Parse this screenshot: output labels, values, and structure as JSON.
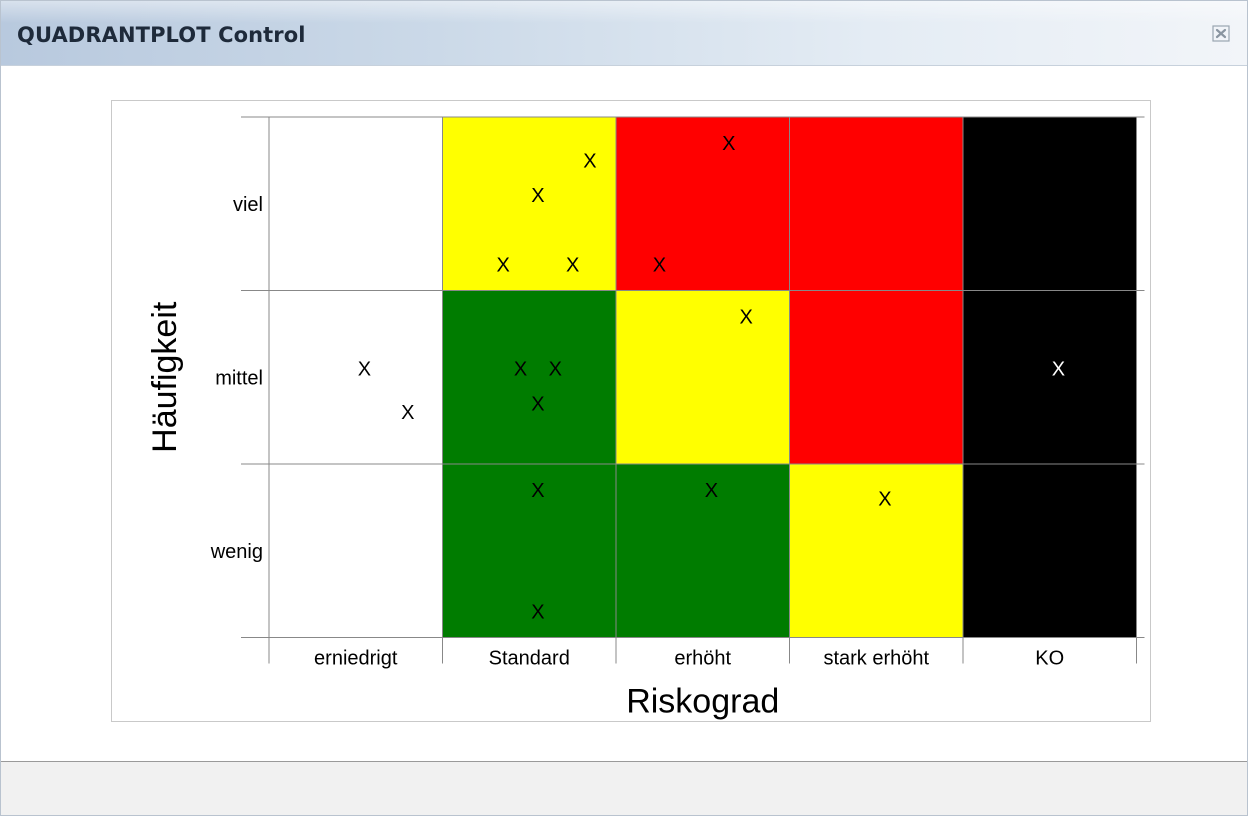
{
  "window": {
    "title": "QUADRANTPLOT Control",
    "close_icon": "close-icon"
  },
  "colors": {
    "green": "#007c00",
    "yellow": "#ffff00",
    "red": "#ff0000",
    "black": "#000000",
    "white": "#ffffff"
  },
  "chart_data": {
    "type": "heatmap",
    "xlabel": "Riskograd",
    "ylabel": "Häufigkeit",
    "x_categories": [
      "erniedrigt",
      "Standard",
      "erhöht",
      "stark erhöht",
      "KO"
    ],
    "y_categories": [
      "wenig",
      "mittel",
      "viel"
    ],
    "cell_colors": [
      [
        "white",
        "green",
        "green",
        "yellow",
        "black"
      ],
      [
        "white",
        "green",
        "yellow",
        "red",
        "black"
      ],
      [
        "white",
        "yellow",
        "red",
        "red",
        "black"
      ]
    ],
    "marker_symbol": "X",
    "points": [
      {
        "x": "erniedrigt",
        "y": "mittel",
        "dx": 0.55,
        "dy": 0.55
      },
      {
        "x": "erniedrigt",
        "y": "mittel",
        "dx": 0.8,
        "dy": 0.3
      },
      {
        "x": "Standard",
        "y": "viel",
        "dx": 0.85,
        "dy": 0.75
      },
      {
        "x": "Standard",
        "y": "viel",
        "dx": 0.55,
        "dy": 0.55
      },
      {
        "x": "Standard",
        "y": "viel",
        "dx": 0.35,
        "dy": 0.15
      },
      {
        "x": "Standard",
        "y": "viel",
        "dx": 0.75,
        "dy": 0.15
      },
      {
        "x": "Standard",
        "y": "mittel",
        "dx": 0.45,
        "dy": 0.55
      },
      {
        "x": "Standard",
        "y": "mittel",
        "dx": 0.65,
        "dy": 0.55
      },
      {
        "x": "Standard",
        "y": "mittel",
        "dx": 0.55,
        "dy": 0.35
      },
      {
        "x": "Standard",
        "y": "wenig",
        "dx": 0.55,
        "dy": 0.85
      },
      {
        "x": "Standard",
        "y": "wenig",
        "dx": 0.55,
        "dy": 0.15
      },
      {
        "x": "erhöht",
        "y": "viel",
        "dx": 0.65,
        "dy": 0.85
      },
      {
        "x": "erhöht",
        "y": "viel",
        "dx": 0.25,
        "dy": 0.15
      },
      {
        "x": "erhöht",
        "y": "mittel",
        "dx": 0.75,
        "dy": 0.85
      },
      {
        "x": "erhöht",
        "y": "wenig",
        "dx": 0.55,
        "dy": 0.85
      },
      {
        "x": "stark erhöht",
        "y": "wenig",
        "dx": 0.55,
        "dy": 0.8
      },
      {
        "x": "KO",
        "y": "mittel",
        "dx": 0.55,
        "dy": 0.55
      }
    ],
    "grid": true
  }
}
